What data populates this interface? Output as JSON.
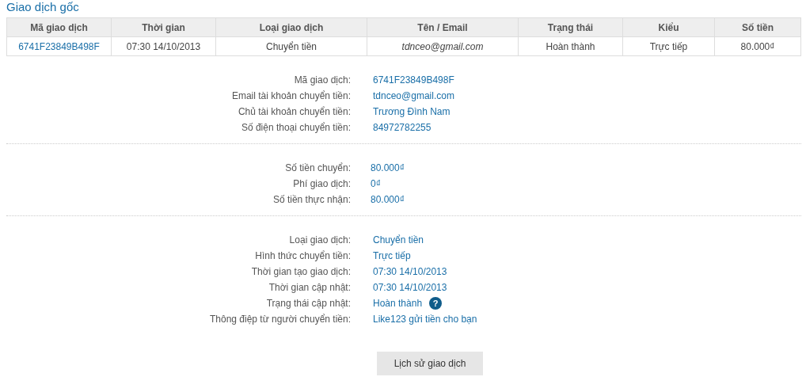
{
  "section_title": "Giao dịch gốc",
  "table": {
    "columns": [
      "Mã giao dịch",
      "Thời gian",
      "Loại giao dịch",
      "Tên / Email",
      "Trạng thái",
      "Kiểu",
      "Số tiền"
    ],
    "rows": [
      {
        "cells": [
          "6741F23849B498F",
          "07:30 14/10/2013",
          "Chuyển tiền",
          "tdnceo@gmail.com",
          "Hoàn thành",
          "Trực tiếp",
          "80.000₫"
        ]
      }
    ]
  },
  "detail_groups": [
    {
      "rows": [
        {
          "label": "Mã giao dịch:",
          "value": "6741F23849B498F"
        },
        {
          "label": "Email tài khoản chuyển tiền:",
          "value": "tdnceo@gmail.com"
        },
        {
          "label": "Chủ tài khoản chuyển tiền:",
          "value": "Trương Đình Nam"
        },
        {
          "label": "Số điện thoại chuyển tiền:",
          "value": "84972782255"
        }
      ]
    },
    {
      "rows": [
        {
          "label": "Số tiền chuyển:",
          "value": "80.000₫"
        },
        {
          "label": "Phí giao dịch:",
          "value": "0₫"
        },
        {
          "label": "Số tiền thực nhận:",
          "value": "80.000₫"
        }
      ]
    },
    {
      "rows": [
        {
          "label": "Loại giao dịch:",
          "value": "Chuyển tiền"
        },
        {
          "label": "Hình thức chuyển tiền:",
          "value": "Trực tiếp"
        },
        {
          "label": "Thời gian tạo giao dịch:",
          "value": "07:30 14/10/2013"
        },
        {
          "label": "Thời gian cập nhật:",
          "value": "07:30 14/10/2013"
        },
        {
          "label": "Trạng thái cập nhật:",
          "value": "Hoàn thành",
          "help": "?"
        },
        {
          "label": "Thông điệp từ người chuyển tiền:",
          "value": "Like123 gửi tiền cho bạn"
        }
      ]
    }
  ],
  "button": "Lịch sử giao dịch"
}
